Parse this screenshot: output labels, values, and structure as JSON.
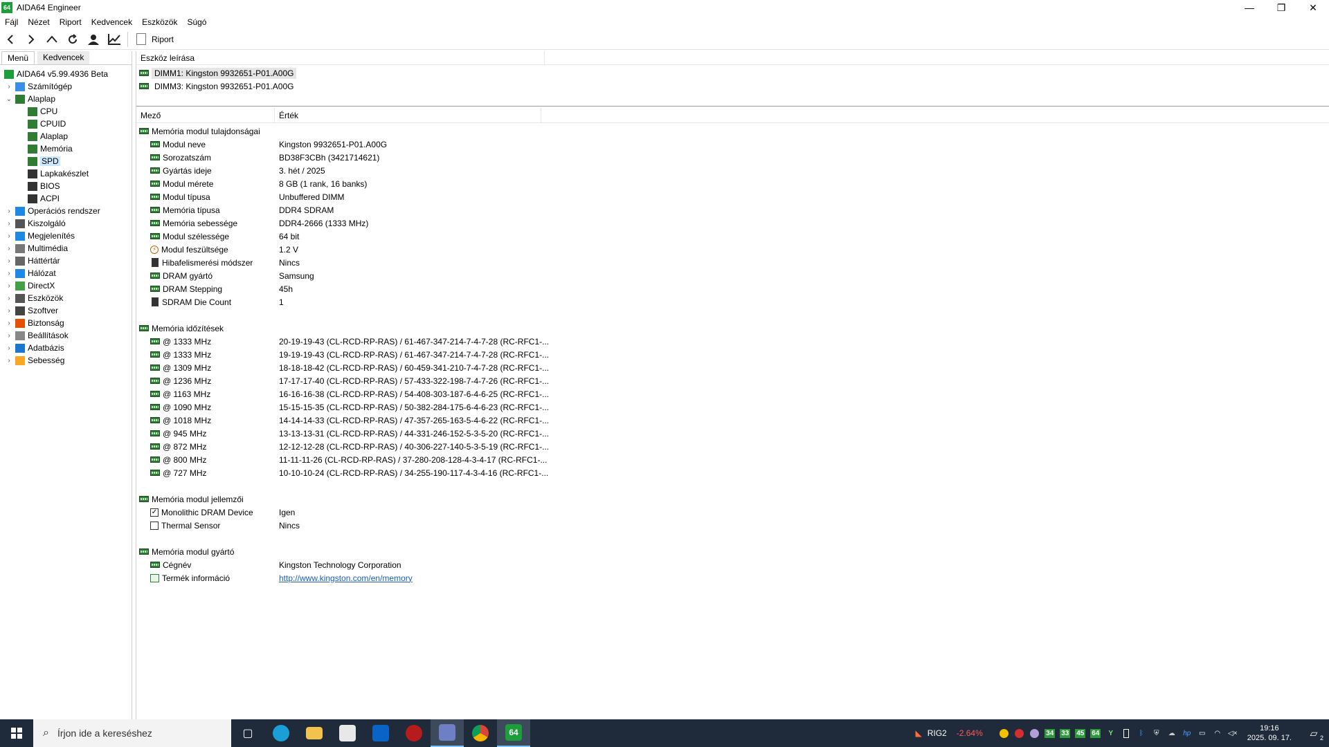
{
  "window": {
    "title": "AIDA64 Engineer",
    "app_icon_text": "64",
    "minimize": "—",
    "restore": "❐",
    "close": "✕"
  },
  "menu": [
    "Fájl",
    "Nézet",
    "Riport",
    "Kedvencek",
    "Eszközök",
    "Súgó"
  ],
  "toolbar": {
    "report_label": "Riport"
  },
  "left_tabs": {
    "menu": "Menü",
    "favorites": "Kedvencek"
  },
  "tree": {
    "root": "AIDA64 v5.99.4936 Beta",
    "items": [
      {
        "label": "Számítógép",
        "level": 1,
        "expand": "›",
        "icon": "computer"
      },
      {
        "label": "Alaplap",
        "level": 1,
        "expand": "⌄",
        "icon": "motherboard"
      },
      {
        "label": "CPU",
        "level": 2,
        "icon": "cpu"
      },
      {
        "label": "CPUID",
        "level": 2,
        "icon": "cpu"
      },
      {
        "label": "Alaplap",
        "level": 2,
        "icon": "motherboard"
      },
      {
        "label": "Memória",
        "level": 2,
        "icon": "memory"
      },
      {
        "label": "SPD",
        "level": 2,
        "icon": "memory",
        "selected": true
      },
      {
        "label": "Lapkakészlet",
        "level": 2,
        "icon": "chip"
      },
      {
        "label": "BIOS",
        "level": 2,
        "icon": "chip"
      },
      {
        "label": "ACPI",
        "level": 2,
        "icon": "chip"
      },
      {
        "label": "Operációs rendszer",
        "level": 1,
        "expand": "›",
        "icon": "windows"
      },
      {
        "label": "Kiszolgáló",
        "level": 1,
        "expand": "›",
        "icon": "server"
      },
      {
        "label": "Megjelenítés",
        "level": 1,
        "expand": "›",
        "icon": "display"
      },
      {
        "label": "Multimédia",
        "level": 1,
        "expand": "›",
        "icon": "speaker"
      },
      {
        "label": "Háttértár",
        "level": 1,
        "expand": "›",
        "icon": "storage"
      },
      {
        "label": "Hálózat",
        "level": 1,
        "expand": "›",
        "icon": "network"
      },
      {
        "label": "DirectX",
        "level": 1,
        "expand": "›",
        "icon": "directx"
      },
      {
        "label": "Eszközök",
        "level": 1,
        "expand": "›",
        "icon": "devices"
      },
      {
        "label": "Szoftver",
        "level": 1,
        "expand": "›",
        "icon": "software"
      },
      {
        "label": "Biztonság",
        "level": 1,
        "expand": "›",
        "icon": "shield"
      },
      {
        "label": "Beállítások",
        "level": 1,
        "expand": "›",
        "icon": "settings"
      },
      {
        "label": "Adatbázis",
        "level": 1,
        "expand": "›",
        "icon": "database"
      },
      {
        "label": "Sebesség",
        "level": 1,
        "expand": "›",
        "icon": "benchmark"
      }
    ]
  },
  "device_panel": {
    "header": "Eszköz leírása",
    "items": [
      "DIMM1: Kingston 9932651-P01.A00G",
      "DIMM3: Kingston 9932651-P01.A00G"
    ]
  },
  "table": {
    "col_field": "Mező",
    "col_value": "Érték",
    "sections": [
      {
        "title": "Memória modul tulajdonságai",
        "rows": [
          {
            "field": "Modul neve",
            "value": "Kingston 9932651-P01.A00G",
            "icon": "ram"
          },
          {
            "field": "Sorozatszám",
            "value": "BD38F3CBh (3421714621)",
            "icon": "ram"
          },
          {
            "field": "Gyártás ideje",
            "value": "3. hét / 2025",
            "icon": "ram"
          },
          {
            "field": "Modul mérete",
            "value": "8 GB (1 rank, 16 banks)",
            "icon": "ram"
          },
          {
            "field": "Modul típusa",
            "value": "Unbuffered DIMM",
            "icon": "ram"
          },
          {
            "field": "Memória típusa",
            "value": "DDR4 SDRAM",
            "icon": "ram"
          },
          {
            "field": "Memória sebessége",
            "value": "DDR4-2666 (1333 MHz)",
            "icon": "ram"
          },
          {
            "field": "Modul szélessége",
            "value": "64 bit",
            "icon": "ram"
          },
          {
            "field": "Modul feszültsége",
            "value": "1.2 V",
            "icon": "voltage"
          },
          {
            "field": "Hibafelismerési módszer",
            "value": "Nincs",
            "icon": "chip"
          },
          {
            "field": "DRAM gyártó",
            "value": "Samsung",
            "icon": "ram"
          },
          {
            "field": "DRAM Stepping",
            "value": "45h",
            "icon": "ram"
          },
          {
            "field": "SDRAM Die Count",
            "value": "1",
            "icon": "chip"
          }
        ]
      },
      {
        "title": "Memória időzítések",
        "rows": [
          {
            "field": "@ 1333 MHz",
            "value": "20-19-19-43  (CL-RCD-RP-RAS) / 61-467-347-214-7-4-7-28  (RC-RFC1-...",
            "icon": "ram"
          },
          {
            "field": "@ 1333 MHz",
            "value": "19-19-19-43  (CL-RCD-RP-RAS) / 61-467-347-214-7-4-7-28  (RC-RFC1-...",
            "icon": "ram"
          },
          {
            "field": "@ 1309 MHz",
            "value": "18-18-18-42  (CL-RCD-RP-RAS) / 60-459-341-210-7-4-7-28  (RC-RFC1-...",
            "icon": "ram"
          },
          {
            "field": "@ 1236 MHz",
            "value": "17-17-17-40  (CL-RCD-RP-RAS) / 57-433-322-198-7-4-7-26  (RC-RFC1-...",
            "icon": "ram"
          },
          {
            "field": "@ 1163 MHz",
            "value": "16-16-16-38  (CL-RCD-RP-RAS) / 54-408-303-187-6-4-6-25  (RC-RFC1-...",
            "icon": "ram"
          },
          {
            "field": "@ 1090 MHz",
            "value": "15-15-15-35  (CL-RCD-RP-RAS) / 50-382-284-175-6-4-6-23  (RC-RFC1-...",
            "icon": "ram"
          },
          {
            "field": "@ 1018 MHz",
            "value": "14-14-14-33  (CL-RCD-RP-RAS) / 47-357-265-163-5-4-6-22  (RC-RFC1-...",
            "icon": "ram"
          },
          {
            "field": "@ 945 MHz",
            "value": "13-13-13-31  (CL-RCD-RP-RAS) / 44-331-246-152-5-3-5-20  (RC-RFC1-...",
            "icon": "ram"
          },
          {
            "field": "@ 872 MHz",
            "value": "12-12-12-28  (CL-RCD-RP-RAS) / 40-306-227-140-5-3-5-19  (RC-RFC1-...",
            "icon": "ram"
          },
          {
            "field": "@ 800 MHz",
            "value": "11-11-11-26  (CL-RCD-RP-RAS) / 37-280-208-128-4-3-4-17  (RC-RFC1-...",
            "icon": "ram"
          },
          {
            "field": "@ 727 MHz",
            "value": "10-10-10-24  (CL-RCD-RP-RAS) / 34-255-190-117-4-3-4-16  (RC-RFC1-...",
            "icon": "ram"
          }
        ]
      },
      {
        "title": "Memória modul jellemzői",
        "rows": [
          {
            "field": "Monolithic DRAM Device",
            "value": "Igen",
            "icon": "checkbox-checked"
          },
          {
            "field": "Thermal Sensor",
            "value": "Nincs",
            "icon": "checkbox-empty"
          }
        ]
      },
      {
        "title": "Memória modul gyártó",
        "rows": [
          {
            "field": "Cégnév",
            "value": "Kingston Technology Corporation",
            "icon": "ram"
          },
          {
            "field": "Termék információ",
            "value": "http://www.kingston.com/en/memory",
            "icon": "link",
            "is_link": true
          }
        ]
      }
    ]
  },
  "taskbar": {
    "search_placeholder": "Írjon ide a kereséshez",
    "rig_label": "RIG2",
    "rig_change": "-2.64%",
    "tray_badges": [
      "34",
      "33",
      "45",
      "64"
    ],
    "time": "19:16",
    "date": "2025. 09. 17.",
    "notifications": "2"
  }
}
